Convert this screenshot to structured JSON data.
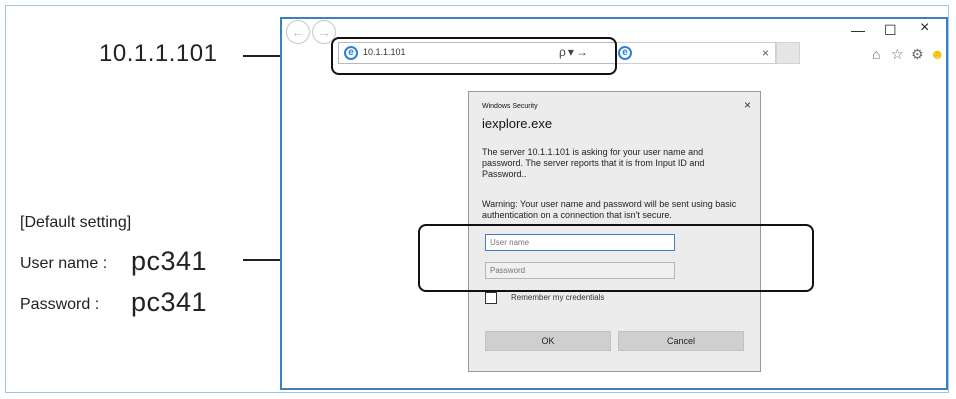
{
  "callouts": {
    "ip_address": "10.1.1.101",
    "default_heading": "[Default setting]",
    "user_name_label": "User name :",
    "user_name_value": "pc341",
    "password_label": "Password :",
    "password_value": "pc341"
  },
  "browser": {
    "address_url": "10.1.1.101",
    "address_tools": "ρ▾→",
    "tab_close": "×",
    "window_controls": {
      "minimize": "—",
      "maximize": "☐",
      "close": "×"
    },
    "toolbar_icons": {
      "home": "⌂",
      "favorites": "☆",
      "settings": "⚙",
      "smiley": "☻"
    }
  },
  "dialog": {
    "caption": "Windows Security",
    "close": "×",
    "title": "iexplore.exe",
    "message": "The server 10.1.1.101 is asking for your user name and password. The server reports that it is from Input ID and Password..",
    "warning": "Warning: Your user name and password will be sent using basic authentication on a connection that isn't secure.",
    "username_placeholder": "User name",
    "password_placeholder": "Password",
    "remember_label": "Remember my credentials",
    "ok_label": "OK",
    "cancel_label": "Cancel"
  },
  "colors": {
    "browser_border": "#3d7fc1",
    "ie_blue": "#2a82d8",
    "smiley": "#f2c200",
    "dialog_bg": "#ececec",
    "button_bg": "#cfcfcf"
  }
}
